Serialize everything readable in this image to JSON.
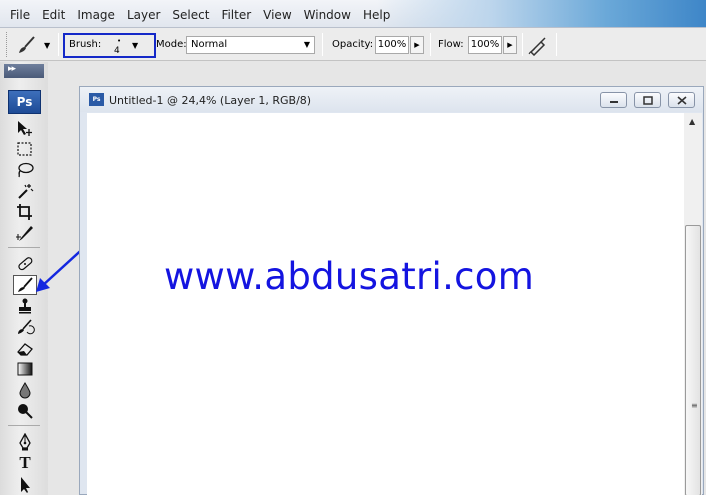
{
  "menubar": {
    "items": [
      "File",
      "Edit",
      "Image",
      "Layer",
      "Select",
      "Filter",
      "View",
      "Window",
      "Help"
    ]
  },
  "options": {
    "brush_label": "Brush:",
    "brush_size": "4",
    "mode_label": "Mode:",
    "mode_value": "Normal",
    "opacity_label": "Opacity:",
    "opacity_value": "100%",
    "flow_label": "Flow:",
    "flow_value": "100%"
  },
  "tools": {
    "logo": "Ps",
    "items": [
      "move-tool",
      "marquee-tool",
      "lasso-tool",
      "magic-wand-tool",
      "crop-tool",
      "slice-tool",
      "healing-brush-tool",
      "brush-tool",
      "clone-stamp-tool",
      "history-brush-tool",
      "eraser-tool",
      "gradient-tool",
      "blur-tool",
      "dodge-tool",
      "pen-tool",
      "type-tool",
      "path-selection-tool"
    ],
    "active": "brush-tool",
    "type_glyph": "T"
  },
  "document": {
    "title": "Untitled-1 @ 24,4% (Layer 1, RGB/8)",
    "icon_text": "Ps",
    "watermark": "www.abdusatri.com"
  },
  "colors": {
    "highlight": "#1428c8",
    "watermark": "#1414e0",
    "accent_arrow": "#1428e0"
  }
}
